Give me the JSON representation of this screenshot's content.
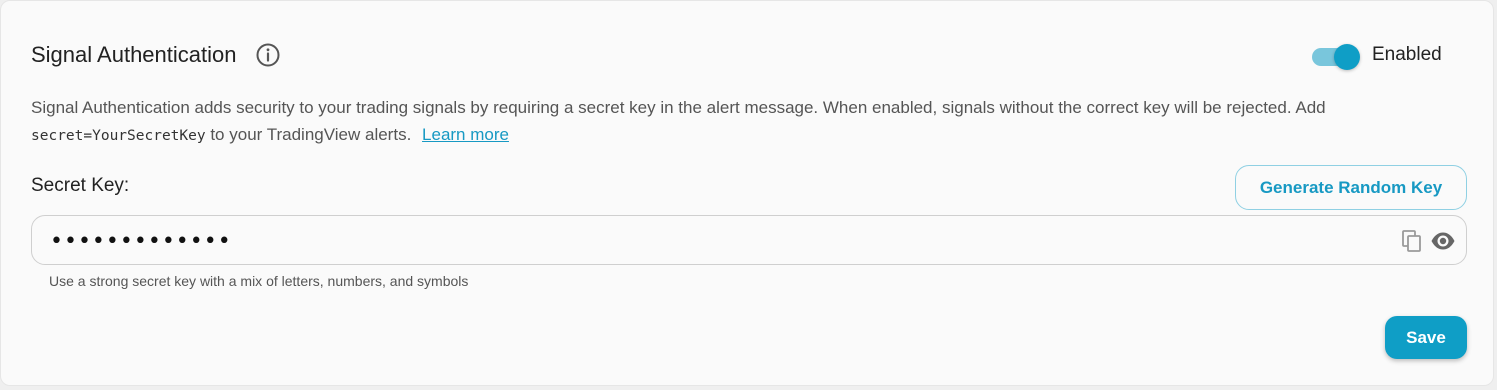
{
  "section": {
    "title": "Signal Authentication",
    "icon": "info-icon"
  },
  "toggle": {
    "label": "Enabled",
    "state": "on",
    "color": "#0f9ec6"
  },
  "description": {
    "text_before": "Signal Authentication adds security to your trading signals by requiring a secret key in the alert message. When enabled, signals without the correct key will be rejected. Add",
    "code": "secret=YourSecretKey",
    "text_after": " to your TradingView alerts.",
    "link": "Learn more"
  },
  "secret_key": {
    "label": "Secret Key:",
    "value": "•••••••••••••",
    "hint": "Use a strong secret key with a mix of letters, numbers, and symbols",
    "copy_icon": "copy-icon",
    "visibility_icon": "eye-icon"
  },
  "buttons": {
    "generate": "Generate Random Key",
    "save": "Save"
  },
  "colors": {
    "accent": "#0f9ec6",
    "link": "#1799c3"
  }
}
